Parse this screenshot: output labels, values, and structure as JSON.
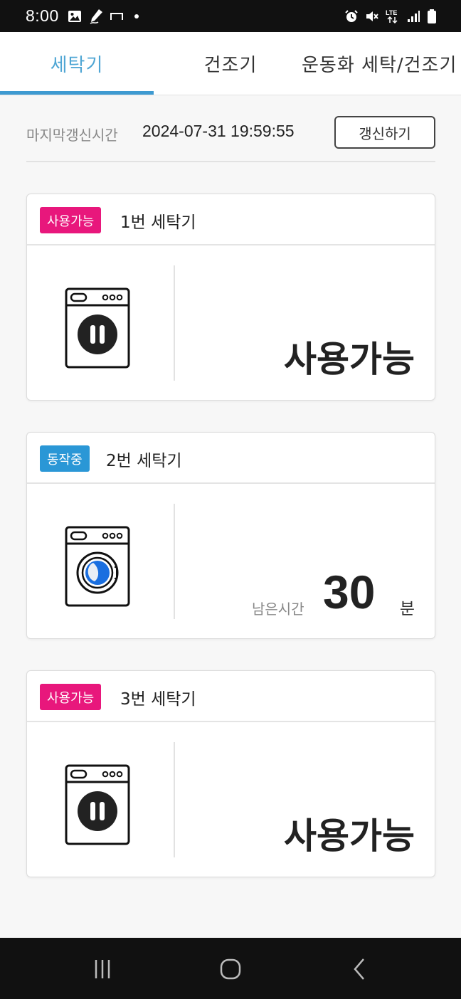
{
  "status_bar": {
    "time": "8:00"
  },
  "tabs": [
    {
      "label": "세탁기"
    },
    {
      "label": "건조기"
    },
    {
      "label": "운동화 세탁/건조기"
    }
  ],
  "refresh": {
    "label": "마지막갱신시간",
    "timestamp": "2024-07-31 19:59:55",
    "button_label": "갱신하기"
  },
  "machines": [
    {
      "badge": "사용가능",
      "name": "1번 세탁기",
      "state": "available",
      "status_text": "사용가능"
    },
    {
      "badge": "동작중",
      "name": "2번 세탁기",
      "state": "running",
      "remain_label": "남은시간",
      "remain_value": "30",
      "remain_unit": "분"
    },
    {
      "badge": "사용가능",
      "name": "3번 세탁기",
      "state": "available",
      "status_text": "사용가능"
    }
  ],
  "colors": {
    "accent": "#3e9ad1",
    "available_badge": "#e8177c",
    "running_badge": "#2a97d6"
  },
  "icons": {
    "status_left": [
      "image-icon",
      "pen-icon",
      "screen-icon",
      "dot-icon"
    ],
    "status_right": [
      "alarm-icon",
      "mute-icon",
      "lte-icon",
      "signal-icon",
      "battery-icon"
    ],
    "machine_available": "washer-paused-icon",
    "machine_running": "washer-spinning-icon",
    "nav": [
      "recent-apps-icon",
      "home-icon",
      "back-icon"
    ]
  }
}
